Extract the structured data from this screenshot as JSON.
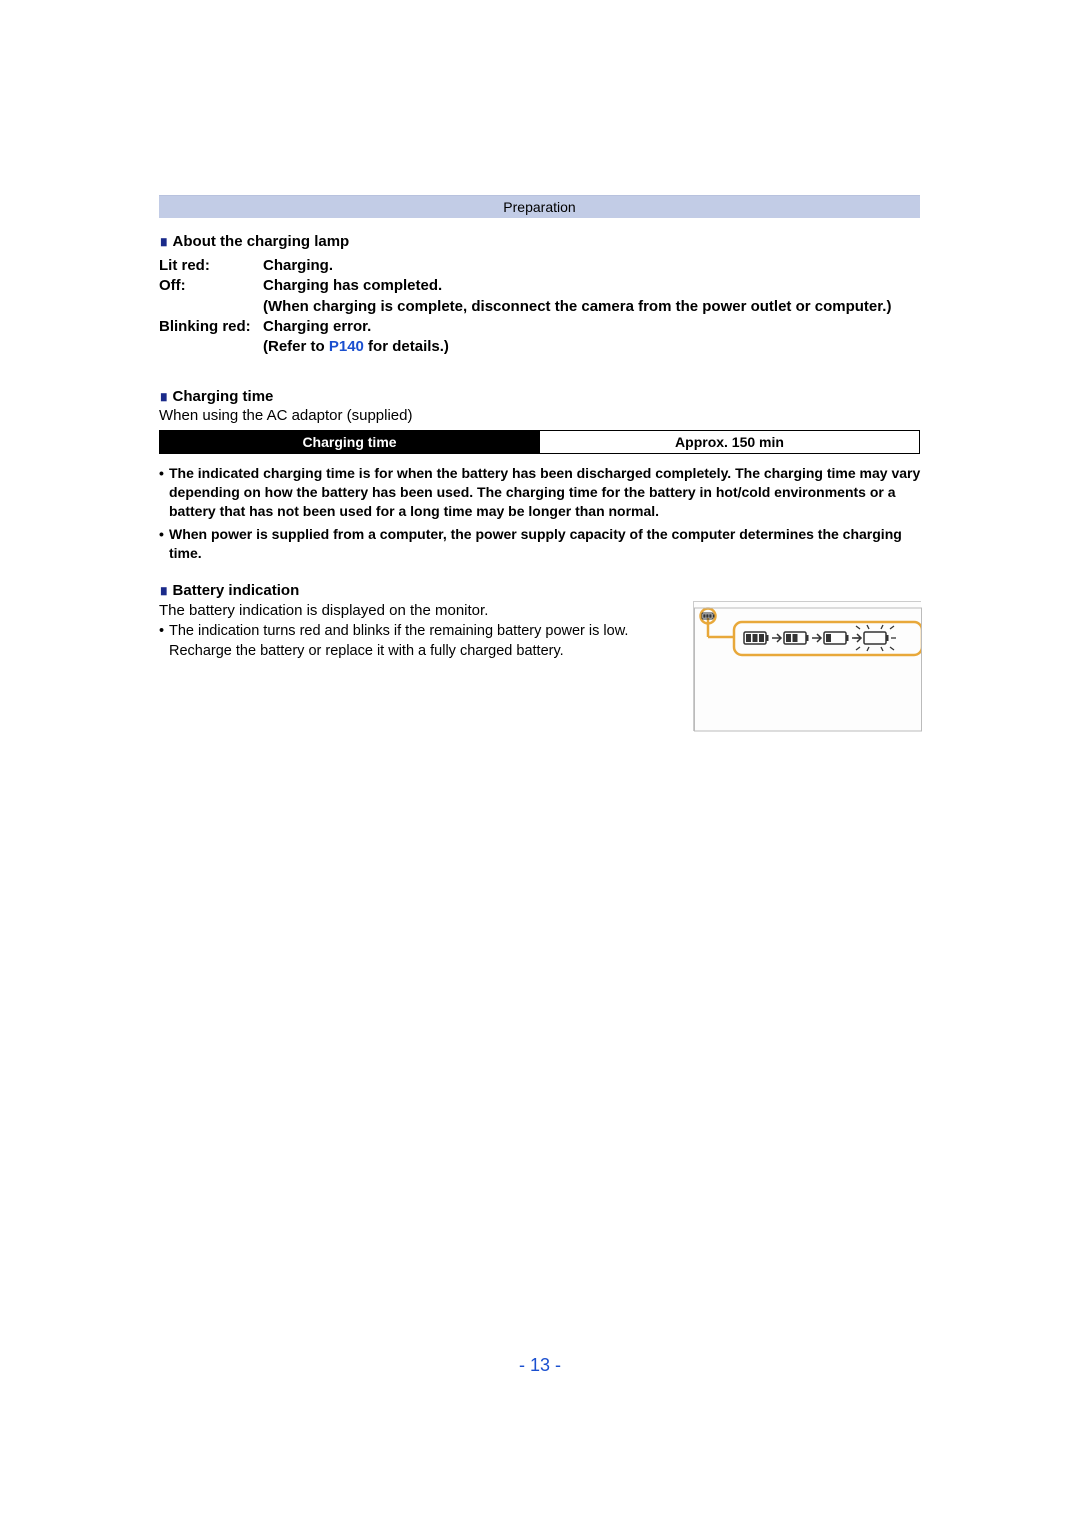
{
  "header": {
    "section_label": "Preparation"
  },
  "lamp": {
    "heading": "About the charging lamp",
    "rows": [
      {
        "label": "Lit red:",
        "value": "Charging."
      },
      {
        "label": "Off:",
        "value": "Charging has completed.",
        "value2": "(When charging is complete, disconnect the camera from the power outlet or computer.)"
      },
      {
        "label": "Blinking red:",
        "value": "Charging error.",
        "value2_pre": "(Refer to ",
        "value2_link": "P140",
        "value2_post": " for details.)"
      }
    ]
  },
  "charging_time": {
    "heading": "Charging time",
    "subtext": "When using the AC adaptor (supplied)",
    "table_header": "Charging time",
    "table_value": "Approx. 150 min",
    "notes": [
      "The indicated charging time is for when the battery has been discharged completely. The charging time may vary depending on how the battery has been used. The charging time for the battery in hot/cold environments or a battery that has not been used for a long time may be longer than normal.",
      "When power is supplied from a computer, the power supply capacity of the computer determines the charging time."
    ]
  },
  "battery_indication": {
    "heading": "Battery indication",
    "line1": "The battery indication is displayed on the monitor.",
    "bullet": "The indication turns red and blinks if the remaining battery power is low. Recharge the battery or replace it with a fully charged battery."
  },
  "page_number": "- 13 -",
  "colors": {
    "header_bg": "#c2cce6",
    "square": "#1a2a8a",
    "link": "#1a4fcf",
    "callout": "#e8a83a"
  }
}
